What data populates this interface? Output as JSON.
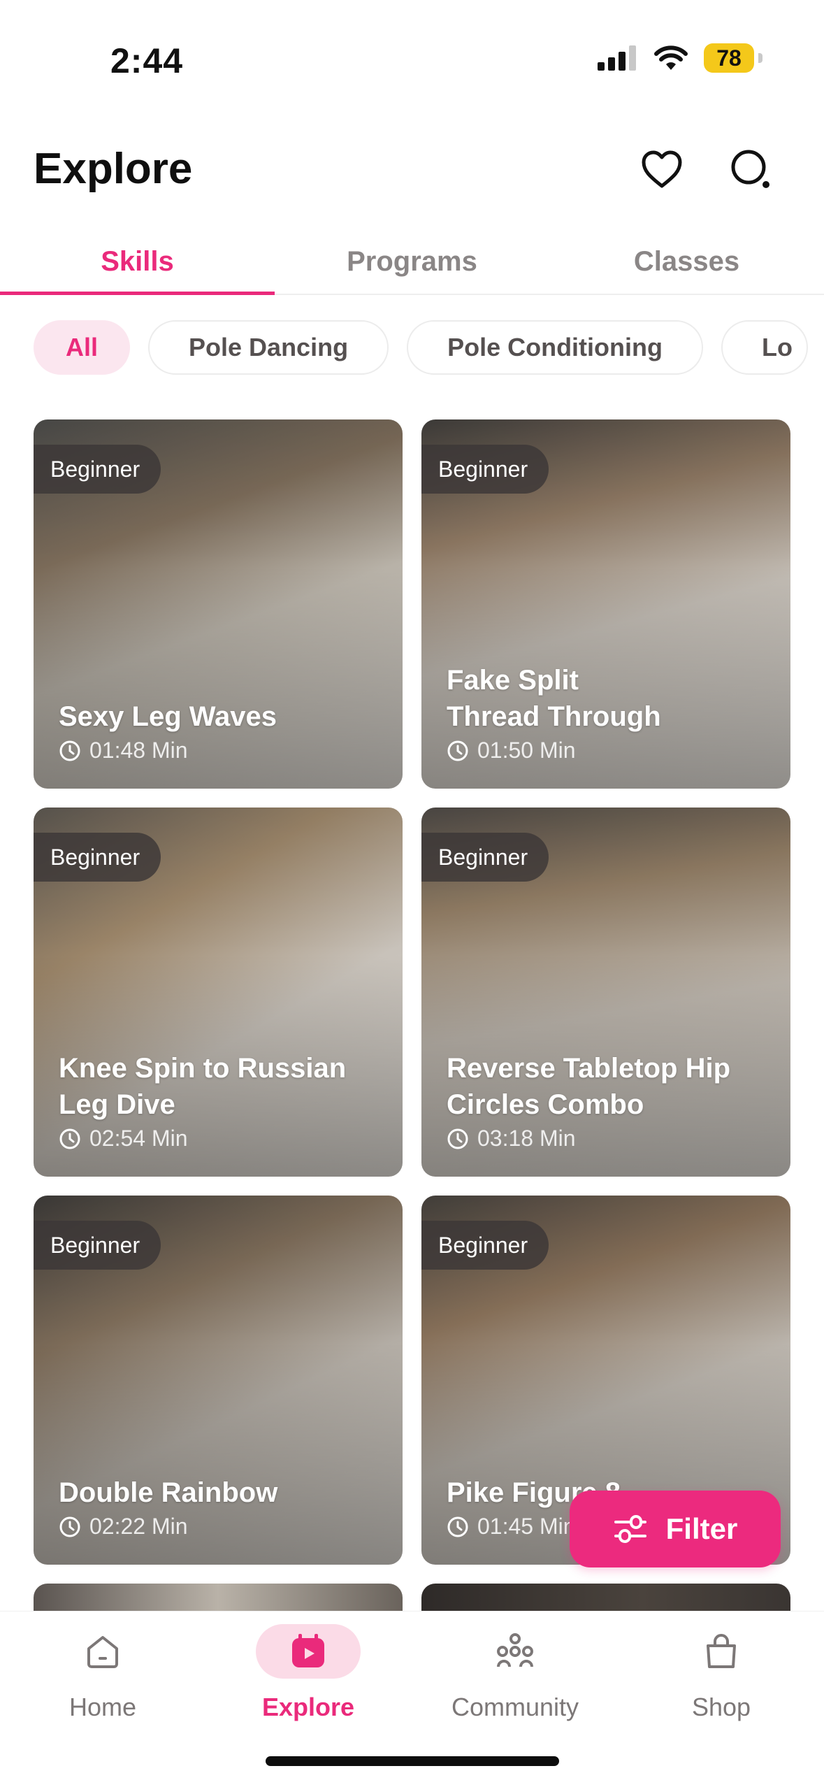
{
  "status_bar": {
    "time": "2:44",
    "battery_level": "78",
    "icons": [
      "signal-icon",
      "wifi-icon",
      "battery-icon"
    ]
  },
  "header": {
    "title": "Explore",
    "icons": [
      "heart-icon",
      "search-icon"
    ]
  },
  "tabs": [
    {
      "label": "Skills",
      "active": true
    },
    {
      "label": "Programs",
      "active": false
    },
    {
      "label": "Classes",
      "active": false
    }
  ],
  "chips": [
    {
      "label": "All",
      "active": true
    },
    {
      "label": "Pole Dancing",
      "active": false
    },
    {
      "label": "Pole Conditioning",
      "active": false
    },
    {
      "label": "Lo",
      "active": false
    }
  ],
  "cards": [
    {
      "level": "Beginner",
      "title": "Sexy Leg Waves",
      "duration": "01:48 Min"
    },
    {
      "level": "Beginner",
      "title": "Fake Split\nThread Through",
      "duration": "01:50 Min"
    },
    {
      "level": "Beginner",
      "title": "Knee Spin to Russian Leg Dive",
      "duration": "02:54 Min"
    },
    {
      "level": "Beginner",
      "title": "Reverse Tabletop Hip Circles Combo",
      "duration": "03:18 Min"
    },
    {
      "level": "Beginner",
      "title": "Double Rainbow",
      "duration": "02:22 Min"
    },
    {
      "level": "Beginner",
      "title": "Pike Figure 8",
      "duration": "01:45 Min"
    }
  ],
  "filter_button": {
    "label": "Filter"
  },
  "bottom_nav": [
    {
      "label": "Home",
      "icon": "home-icon",
      "active": false
    },
    {
      "label": "Explore",
      "icon": "play-calendar-icon",
      "active": true
    },
    {
      "label": "Community",
      "icon": "community-icon",
      "active": false
    },
    {
      "label": "Shop",
      "icon": "shopping-bag-icon",
      "active": false
    }
  ],
  "colors": {
    "accent": "#ea2a7b",
    "accent_light": "#fbe6ef",
    "text_muted": "#8a8686",
    "battery": "#f4c81a"
  }
}
